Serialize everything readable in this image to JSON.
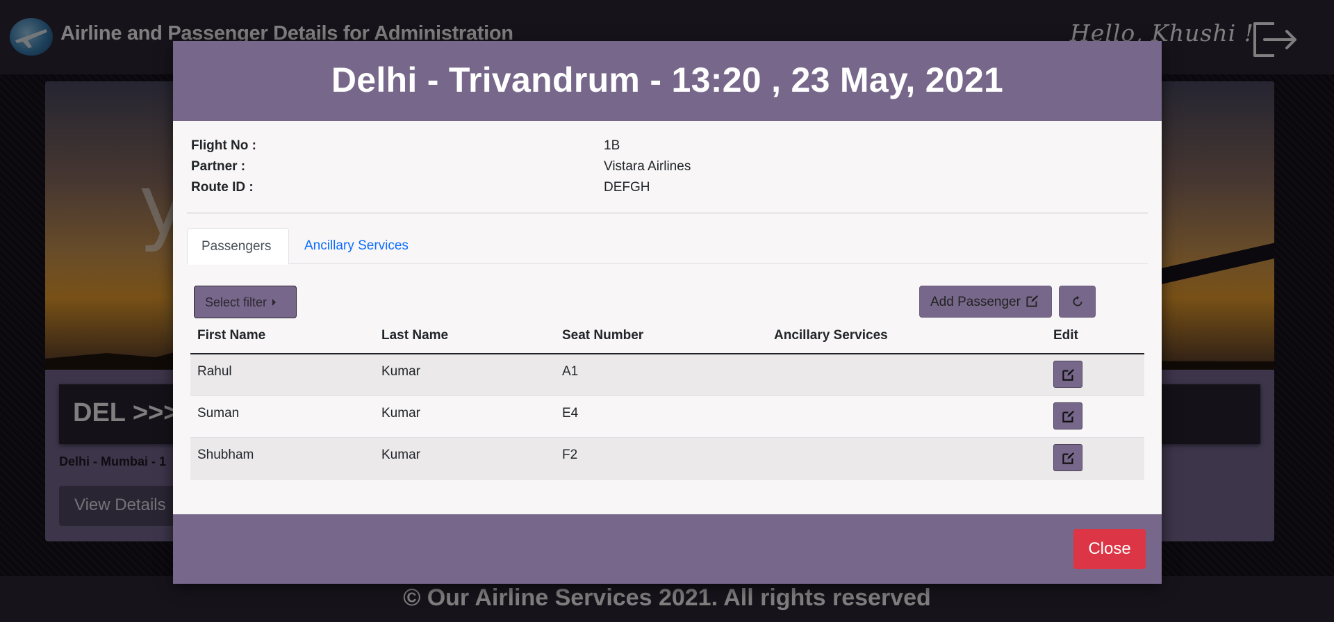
{
  "navbar": {
    "app_title": "Airline and Passenger Details for Administration",
    "greeting": "Hello, Khushi !",
    "logo_icon": "airplane-globe-icon",
    "logout_icon": "logout-icon"
  },
  "background": {
    "route_code": "DEL >>>",
    "route_sub": "Delhi - Mumbai - 1",
    "view_details_label": "View Details"
  },
  "footer": {
    "text": "© Our Airline Services 2021. All rights reserved"
  },
  "modal": {
    "title": "Delhi - Trivandrum - 13:20 , 23 May, 2021",
    "info": [
      {
        "label": "Flight No :",
        "value": "1B"
      },
      {
        "label": "Partner :",
        "value": "Vistara Airlines"
      },
      {
        "label": "Route ID :",
        "value": "DEFGH"
      }
    ],
    "tabs": [
      {
        "label": "Passengers",
        "active": true
      },
      {
        "label": "Ancillary Services",
        "active": false
      }
    ],
    "filter_label": "Select filter",
    "add_passenger_label": "Add Passenger",
    "table": {
      "headers": [
        "First Name",
        "Last Name",
        "Seat Number",
        "Ancillary Services",
        "Edit"
      ],
      "rows": [
        {
          "first": "Rahul",
          "last": "Kumar",
          "seat": "A1",
          "ancillary": ""
        },
        {
          "first": "Suman",
          "last": "Kumar",
          "seat": "E4",
          "ancillary": ""
        },
        {
          "first": "Shubham",
          "last": "Kumar",
          "seat": "F2",
          "ancillary": ""
        }
      ]
    },
    "close_label": "Close"
  },
  "colors": {
    "accent_purple": "#77688b",
    "navbar_dark": "#2e2636",
    "close_red": "#dc3545",
    "link_blue": "#0d6efd"
  }
}
